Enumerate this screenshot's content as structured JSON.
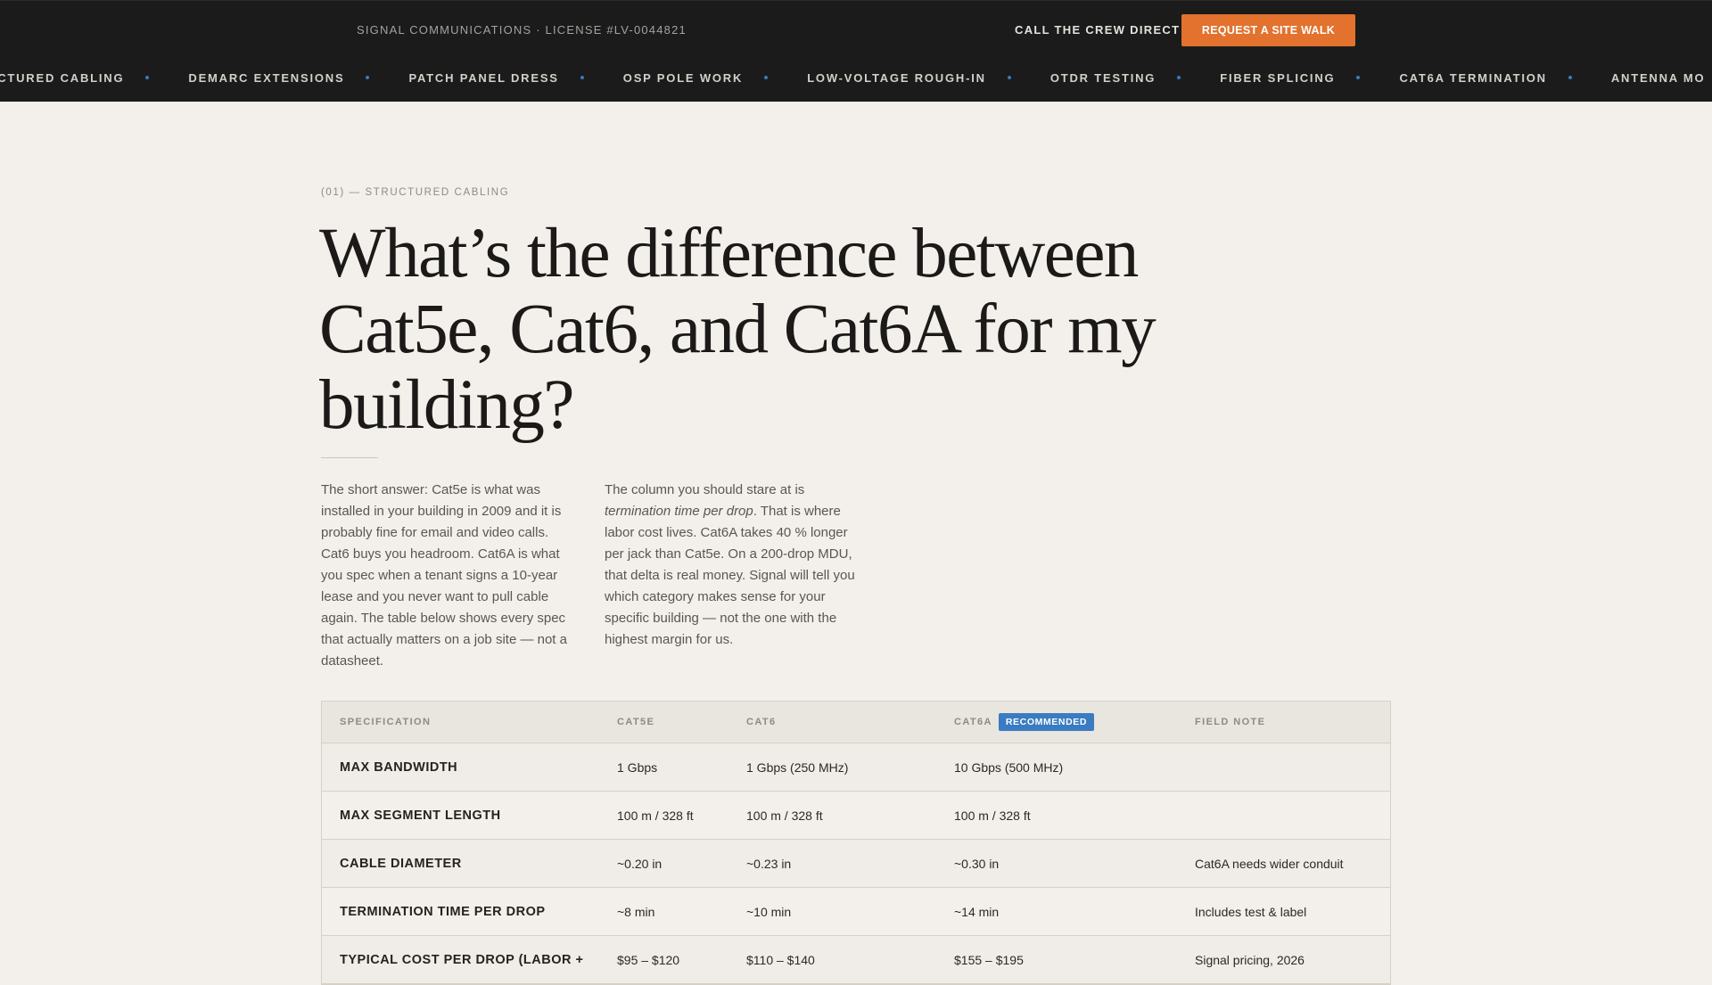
{
  "header": {
    "license": "SIGNAL COMMUNICATIONS · LICENSE #LV-0044821",
    "call_label": "CALL THE CREW DIRECT",
    "cta_label": "REQUEST A SITE WALK",
    "ticker": [
      "UCTURED CABLING",
      "DEMARC EXTENSIONS",
      "PATCH PANEL DRESS",
      "OSP POLE WORK",
      "LOW-VOLTAGE ROUGH-IN",
      "OTDR TESTING",
      "FIBER SPLICING",
      "CAT6A TERMINATION",
      "ANTENNA MO"
    ]
  },
  "article": {
    "eyebrow": "(01) — STRUCTURED CABLING",
    "title": "What’s the difference between Cat5e, Cat6, and Cat6A for my building?",
    "col_a": "The short answer: Cat5e is what was installed in your building in 2009 and it is probably fine for email and video calls. Cat6 buys you headroom. Cat6A is what you spec when a tenant signs a 10-year lease and you never want to pull cable again. The table below shows every spec that actually matters on a job site — not a datasheet.",
    "col_b_pre": "The column you should stare at is ",
    "col_b_em": "termination time per drop",
    "col_b_post": ". That is where labor cost lives. Cat6A takes 40 % longer per jack than Cat5e. On a 200-drop MDU, that delta is real money. Signal will tell you which category makes sense for your specific building — not the one with the highest margin for us."
  },
  "table": {
    "headers": [
      "SPECIFICATION",
      "CAT5E",
      "CAT6",
      "CAT6A",
      "FIELD NOTE"
    ],
    "badge": "RECOMMENDED",
    "rows": [
      [
        "MAX BANDWIDTH",
        "1 Gbps",
        "1 Gbps (250 MHz)",
        "10 Gbps (500 MHz)",
        ""
      ],
      [
        "MAX SEGMENT LENGTH",
        "100 m / 328 ft",
        "100 m / 328 ft",
        "100 m / 328 ft",
        ""
      ],
      [
        "CABLE DIAMETER",
        "~0.20 in",
        "~0.23 in",
        "~0.30 in",
        "Cat6A needs wider conduit"
      ],
      [
        "TERMINATION TIME PER DROP",
        "~8 min",
        "~10 min",
        "~14 min",
        "Includes test & label"
      ],
      [
        "TYPICAL COST PER DROP (LABOR +",
        "$95 – $120",
        "$110 – $140",
        "$155 – $195",
        "Signal pricing, 2026"
      ]
    ]
  }
}
